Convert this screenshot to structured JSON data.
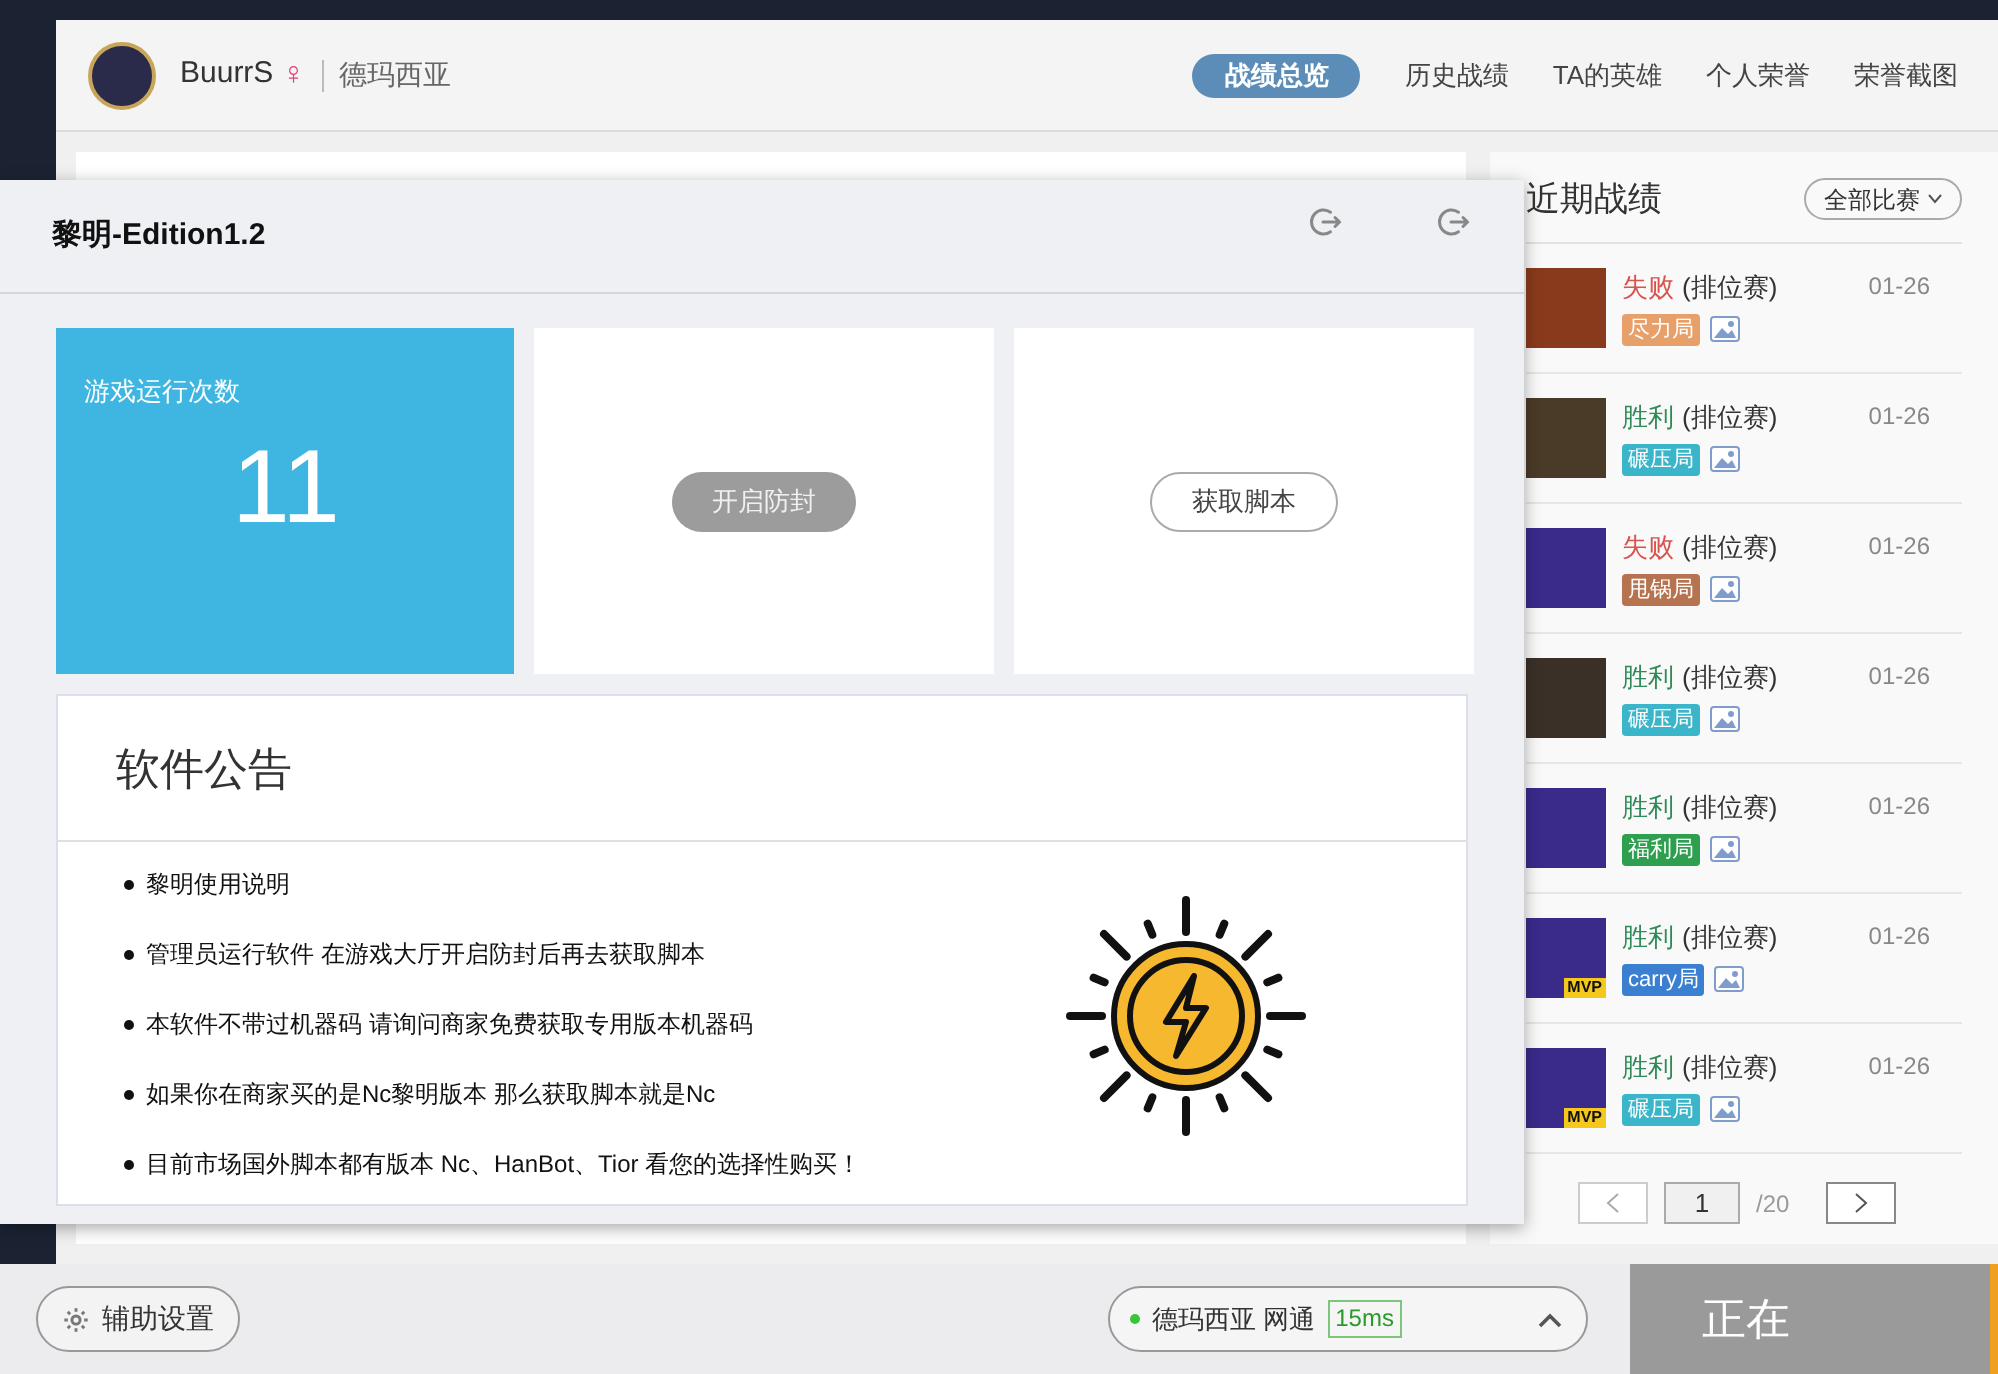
{
  "header": {
    "player_name": "BuurrS",
    "gender_symbol": "♀",
    "server": "德玛西亚",
    "tabs": [
      {
        "label": "战绩总览",
        "selected": true
      },
      {
        "label": "历史战绩",
        "selected": false
      },
      {
        "label": "TA的英雄",
        "selected": false
      },
      {
        "label": "个人荣誉",
        "selected": false
      },
      {
        "label": "荣誉截图",
        "selected": false
      }
    ]
  },
  "overlay": {
    "title": "黎明-Edition1.2",
    "stat_tile": {
      "label": "游戏运行次数",
      "value": "11"
    },
    "actions": [
      {
        "label": "开启防封",
        "disabled": true
      },
      {
        "label": "获取脚本",
        "disabled": false
      }
    ],
    "notice": {
      "title": "软件公告",
      "items": [
        "黎明使用说明",
        "管理员运行软件 在游戏大厅开启防封后再去获取脚本",
        "本软件不带过机器码 请询问商家免费获取专用版本机器码",
        "如果你在商家买的是Nc黎明版本 那么获取脚本就是Nc",
        "目前市场国外脚本都有版本 Nc、HanBot、Tior 看您的选择性购买！"
      ]
    }
  },
  "recent": {
    "title": "近期战绩",
    "filter": "全部比赛",
    "matches": [
      {
        "result": "失败",
        "kind": "loss",
        "mode": "(排位赛)",
        "date": "01-26",
        "tag": "尽力局",
        "color": "#e8a06a"
      },
      {
        "result": "胜利",
        "kind": "win",
        "mode": "(排位赛)",
        "date": "01-26",
        "tag": "碾压局",
        "color": "#3bb5c9"
      },
      {
        "result": "失败",
        "kind": "loss",
        "mode": "(排位赛)",
        "date": "01-26",
        "tag": "甩锅局",
        "color": "#b5734f"
      },
      {
        "result": "胜利",
        "kind": "win",
        "mode": "(排位赛)",
        "date": "01-26",
        "tag": "碾压局",
        "color": "#3bb5c9"
      },
      {
        "result": "胜利",
        "kind": "win",
        "mode": "(排位赛)",
        "date": "01-26",
        "tag": "福利局",
        "color": "#2e9e4f"
      },
      {
        "result": "胜利",
        "kind": "win",
        "mode": "(排位赛)",
        "date": "01-26",
        "tag": "carry局",
        "color": "#3a7fd0",
        "badge": "MVP"
      },
      {
        "result": "胜利",
        "kind": "win",
        "mode": "(排位赛)",
        "date": "01-26",
        "tag": "碾压局",
        "color": "#3bb5c9",
        "badge": "MVP"
      }
    ],
    "pagination": {
      "page": "1",
      "total": "/20"
    }
  },
  "footer": {
    "settings_button": "辅助设置",
    "server": "德玛西亚 网通",
    "ping": "15ms",
    "status": "正在"
  }
}
